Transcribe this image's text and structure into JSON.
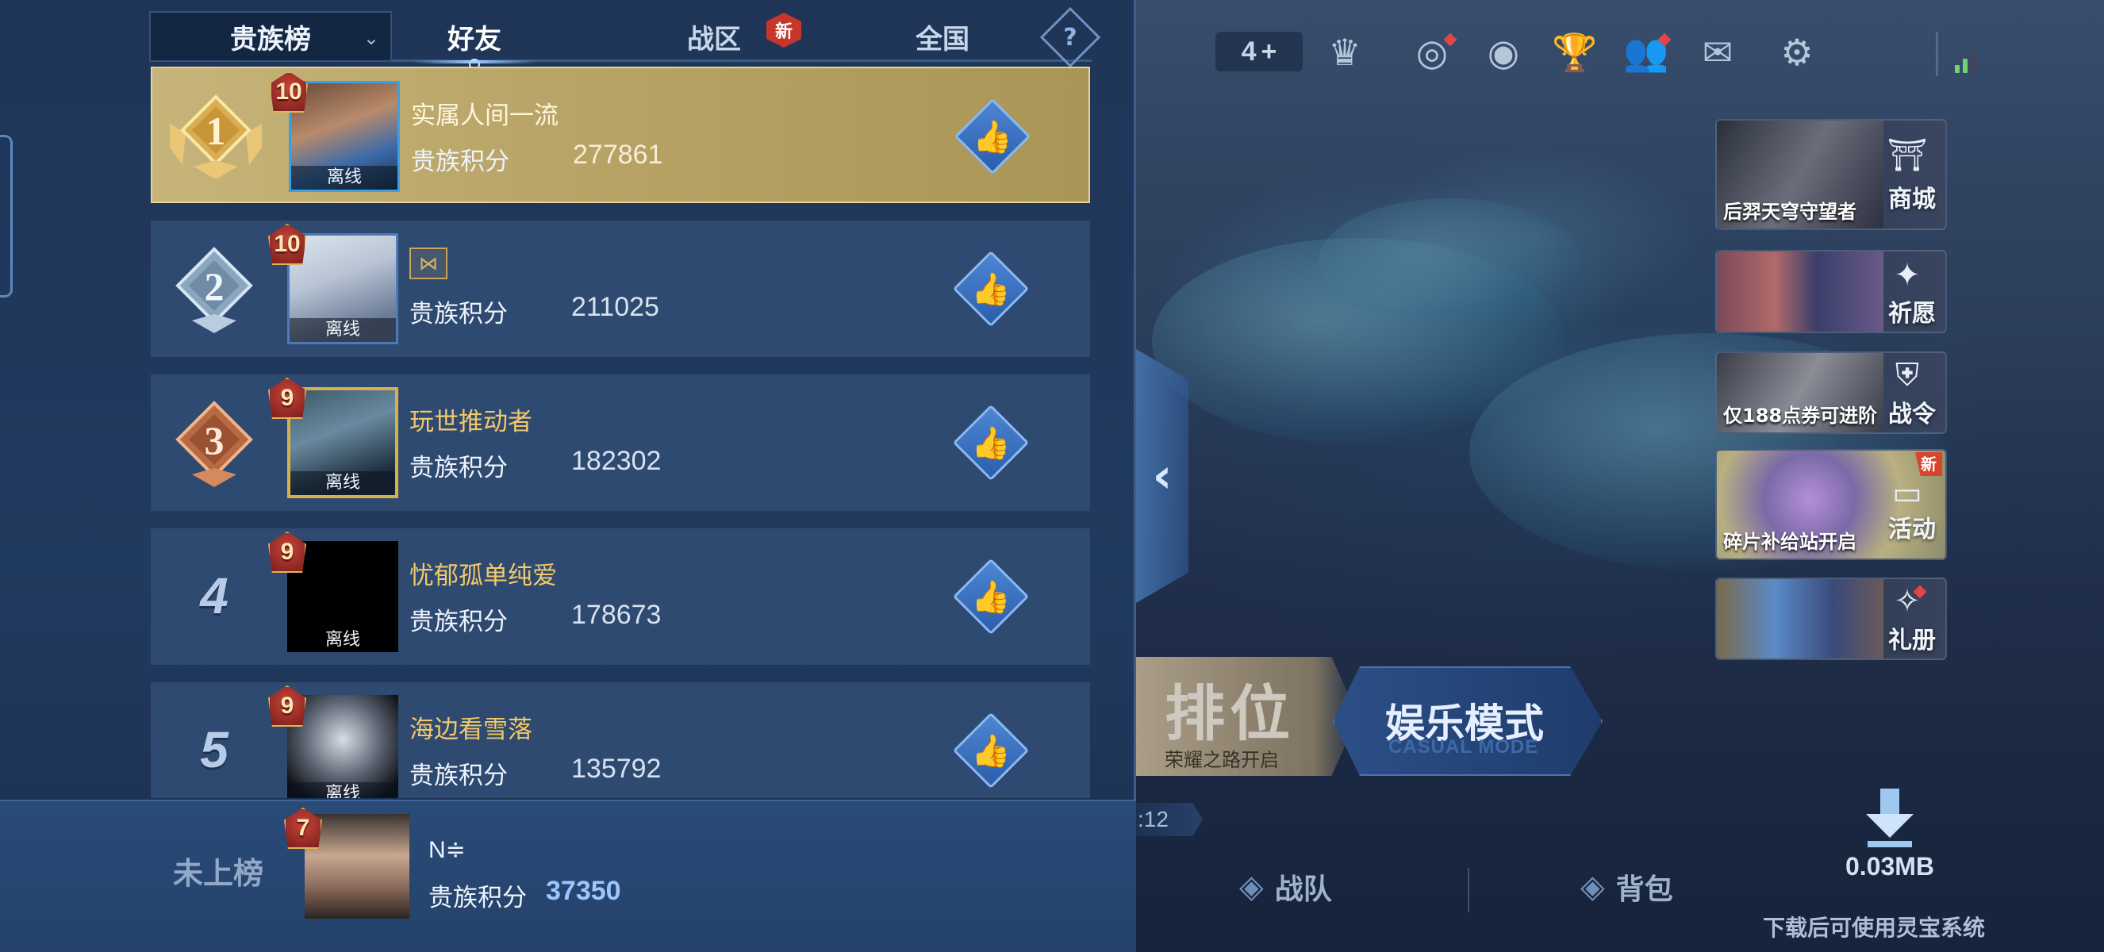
{
  "leaderboard": {
    "dropdown_label": "贵族榜",
    "tabs": [
      {
        "label": "好友",
        "active": true
      },
      {
        "label": "战区",
        "badge": "新"
      },
      {
        "label": "全国"
      }
    ],
    "help_label": "?",
    "score_label": "贵族积分",
    "offline_label": "离线",
    "rows": [
      {
        "rank": "1",
        "noble_level": "10",
        "name": "实属人间一流",
        "score": "277861"
      },
      {
        "rank": "2",
        "noble_level": "10",
        "name": "",
        "name_icon": "mask-icon",
        "score": "211025"
      },
      {
        "rank": "3",
        "noble_level": "9",
        "name": "玩世推动者",
        "score": "182302"
      },
      {
        "rank": "4",
        "noble_level": "9",
        "name": "忧郁孤单纯爱",
        "score": "178673"
      },
      {
        "rank": "5",
        "noble_level": "9",
        "name": "海边看雪落",
        "score": "135792"
      }
    ],
    "self": {
      "rank_label": "未上榜",
      "noble_level": "7",
      "name": "N≑",
      "score_label": "贵族积分",
      "score": "37350"
    }
  },
  "lobby": {
    "plus_count": "4",
    "side_entries": [
      {
        "label": "商城",
        "caption": "后羿天穹守望者"
      },
      {
        "label": "祈愿",
        "caption": ""
      },
      {
        "label": "战令",
        "caption": "仅188点券可进阶"
      },
      {
        "label": "活动",
        "caption": "碎片补给站开启",
        "badge": "新"
      },
      {
        "label": "礼册",
        "caption": ""
      }
    ],
    "ranked_mode": {
      "title": "排位",
      "subtitle": "荣耀之路开启"
    },
    "casual_mode": {
      "title": "娱乐模式",
      "subtitle": "CASUAL MODE"
    },
    "timer": ":12",
    "bottom_nav": [
      {
        "label": "战队"
      },
      {
        "label": "背包"
      }
    ],
    "download": {
      "size": "0.03MB",
      "tip": "下载后可使用灵宝系统"
    }
  },
  "colors": {
    "panel_bg": "#213a5f",
    "row_bg": "#2e4a70",
    "first_row_gold": "#b9a567",
    "name_gold": "#f2c86a",
    "like_blue": "#3b72c4",
    "noble_red": "#a52a22"
  }
}
